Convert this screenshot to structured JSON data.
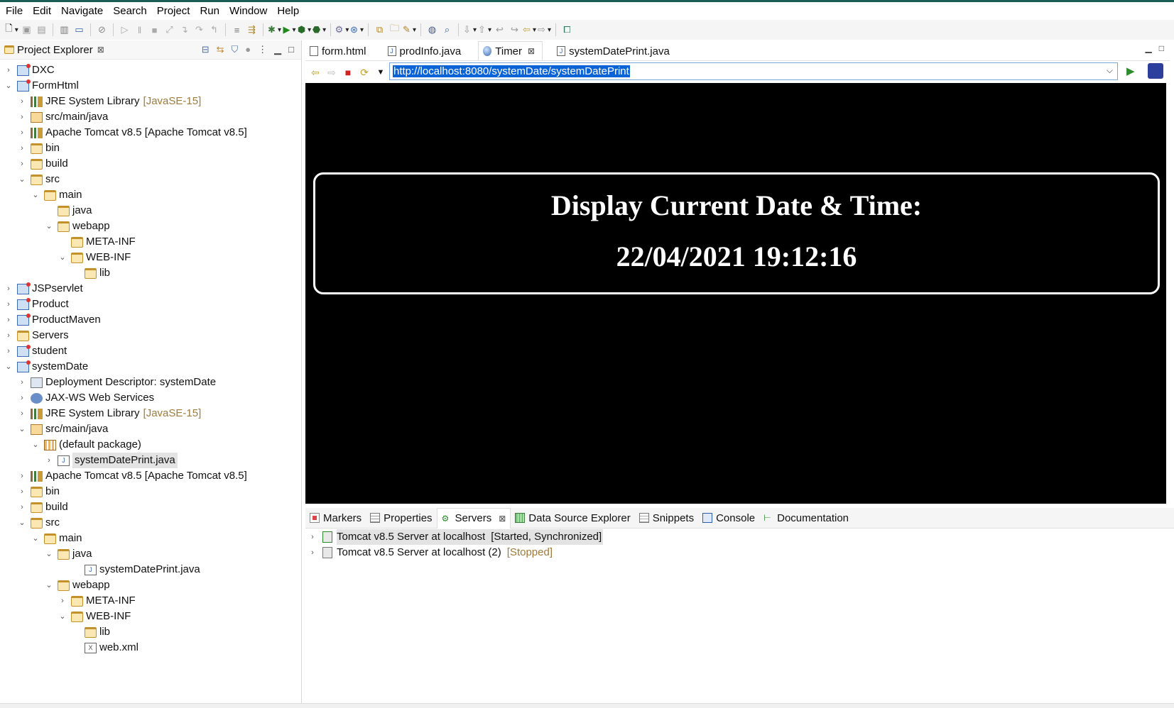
{
  "menu": [
    "File",
    "Edit",
    "Navigate",
    "Search",
    "Project",
    "Run",
    "Window",
    "Help"
  ],
  "project_explorer": {
    "title": "Project Explorer",
    "tree": [
      {
        "label": "DXC",
        "decoration": "",
        "depth": 0,
        "expand": "collapsed",
        "icon": "project-icon"
      },
      {
        "label": "FormHtml",
        "decoration": "",
        "depth": 0,
        "expand": "expanded",
        "icon": "project-icon"
      },
      {
        "label": "JRE System Library",
        "decoration": "[JavaSE-15]",
        "depth": 1,
        "expand": "collapsed",
        "icon": "library-icon"
      },
      {
        "label": "src/main/java",
        "decoration": "",
        "depth": 1,
        "expand": "collapsed",
        "icon": "source-folder-icon"
      },
      {
        "label": "Apache Tomcat v8.5 [Apache Tomcat v8.5]",
        "decoration": "",
        "depth": 1,
        "expand": "collapsed",
        "icon": "library-icon"
      },
      {
        "label": "bin",
        "decoration": "",
        "depth": 1,
        "expand": "collapsed",
        "icon": "folder-icon"
      },
      {
        "label": "build",
        "decoration": "",
        "depth": 1,
        "expand": "collapsed",
        "icon": "folder-icon"
      },
      {
        "label": "src",
        "decoration": "",
        "depth": 1,
        "expand": "expanded",
        "icon": "folder-icon"
      },
      {
        "label": "main",
        "decoration": "",
        "depth": 2,
        "expand": "expanded",
        "icon": "folder-icon"
      },
      {
        "label": "java",
        "decoration": "",
        "depth": 3,
        "expand": "none",
        "icon": "folder-icon"
      },
      {
        "label": "webapp",
        "decoration": "",
        "depth": 3,
        "expand": "expanded",
        "icon": "folder-icon"
      },
      {
        "label": "META-INF",
        "decoration": "",
        "depth": 4,
        "expand": "none",
        "icon": "folder-icon"
      },
      {
        "label": "WEB-INF",
        "decoration": "",
        "depth": 4,
        "expand": "expanded",
        "icon": "folder-icon"
      },
      {
        "label": "lib",
        "decoration": "",
        "depth": 5,
        "expand": "none",
        "icon": "folder-icon"
      },
      {
        "label": "JSPservlet",
        "decoration": "",
        "depth": 0,
        "expand": "collapsed",
        "icon": "project-icon"
      },
      {
        "label": "Product",
        "decoration": "",
        "depth": 0,
        "expand": "collapsed",
        "icon": "project-icon"
      },
      {
        "label": "ProductMaven",
        "decoration": "",
        "depth": 0,
        "expand": "collapsed",
        "icon": "project-icon"
      },
      {
        "label": "Servers",
        "decoration": "",
        "depth": 0,
        "expand": "collapsed",
        "icon": "folder-icon"
      },
      {
        "label": "student",
        "decoration": "",
        "depth": 0,
        "expand": "collapsed",
        "icon": "project-icon"
      },
      {
        "label": "systemDate",
        "decoration": "",
        "depth": 0,
        "expand": "expanded",
        "icon": "project-icon"
      },
      {
        "label": "Deployment Descriptor: systemDate",
        "decoration": "",
        "depth": 1,
        "expand": "collapsed",
        "icon": "descriptor-icon"
      },
      {
        "label": "JAX-WS Web Services",
        "decoration": "",
        "depth": 1,
        "expand": "collapsed",
        "icon": "web-services-icon"
      },
      {
        "label": "JRE System Library",
        "decoration": "[JavaSE-15]",
        "depth": 1,
        "expand": "collapsed",
        "icon": "library-icon"
      },
      {
        "label": "src/main/java",
        "decoration": "",
        "depth": 1,
        "expand": "expanded",
        "icon": "source-folder-icon"
      },
      {
        "label": "(default package)",
        "decoration": "",
        "depth": 2,
        "expand": "expanded",
        "icon": "package-icon"
      },
      {
        "label": "systemDatePrint.java",
        "decoration": "",
        "depth": 3,
        "expand": "collapsed",
        "icon": "java-file-icon",
        "selected": true
      },
      {
        "label": "Apache Tomcat v8.5 [Apache Tomcat v8.5]",
        "decoration": "",
        "depth": 1,
        "expand": "collapsed",
        "icon": "library-icon"
      },
      {
        "label": "bin",
        "decoration": "",
        "depth": 1,
        "expand": "collapsed",
        "icon": "folder-icon"
      },
      {
        "label": "build",
        "decoration": "",
        "depth": 1,
        "expand": "collapsed",
        "icon": "folder-icon"
      },
      {
        "label": "src",
        "decoration": "",
        "depth": 1,
        "expand": "expanded",
        "icon": "folder-icon"
      },
      {
        "label": "main",
        "decoration": "",
        "depth": 2,
        "expand": "expanded",
        "icon": "folder-icon"
      },
      {
        "label": "java",
        "decoration": "",
        "depth": 3,
        "expand": "expanded",
        "icon": "folder-icon"
      },
      {
        "label": "systemDatePrint.java",
        "decoration": "",
        "depth": 5,
        "expand": "none",
        "icon": "java-file-icon"
      },
      {
        "label": "webapp",
        "decoration": "",
        "depth": 3,
        "expand": "expanded",
        "icon": "folder-icon"
      },
      {
        "label": "META-INF",
        "decoration": "",
        "depth": 4,
        "expand": "collapsed",
        "icon": "folder-icon"
      },
      {
        "label": "WEB-INF",
        "decoration": "",
        "depth": 4,
        "expand": "expanded",
        "icon": "folder-icon"
      },
      {
        "label": "lib",
        "decoration": "",
        "depth": 5,
        "expand": "none",
        "icon": "folder-icon"
      },
      {
        "label": "web.xml",
        "decoration": "",
        "depth": 5,
        "expand": "none",
        "icon": "xml-file-icon"
      }
    ]
  },
  "editor": {
    "tabs": [
      {
        "label": "form.html",
        "icon": "html-file-icon",
        "active": false
      },
      {
        "label": "prodInfo.java",
        "icon": "java-file-icon",
        "active": false
      },
      {
        "label": "Timer",
        "icon": "globe-icon",
        "active": true
      },
      {
        "label": "systemDatePrint.java",
        "icon": "java-file-icon",
        "active": false
      }
    ],
    "url": "http://localhost:8080/systemDate/systemDatePrint",
    "page": {
      "heading": "Display Current Date & Time:",
      "datetime": "22/04/2021 19:12:16"
    }
  },
  "bottom_panel": {
    "tabs": [
      {
        "label": "Markers",
        "icon": "markers-icon"
      },
      {
        "label": "Properties",
        "icon": "properties-icon"
      },
      {
        "label": "Servers",
        "icon": "servers-icon",
        "active": true
      },
      {
        "label": "Data Source Explorer",
        "icon": "data-source-icon"
      },
      {
        "label": "Snippets",
        "icon": "snippets-icon"
      },
      {
        "label": "Console",
        "icon": "console-icon"
      },
      {
        "label": "Documentation",
        "icon": "documentation-icon"
      }
    ],
    "servers": [
      {
        "name": "Tomcat v8.5 Server at localhost",
        "state": "[Started, Synchronized]",
        "highlight": true
      },
      {
        "name": "Tomcat v8.5 Server at localhost (2)",
        "state": "[Stopped]",
        "highlight": false
      }
    ]
  },
  "colors": {
    "accent_top": "#1b5e57",
    "url_selection": "#0a64d8",
    "decoration_text": "#a07a3a",
    "browser_bg": "#000000"
  }
}
